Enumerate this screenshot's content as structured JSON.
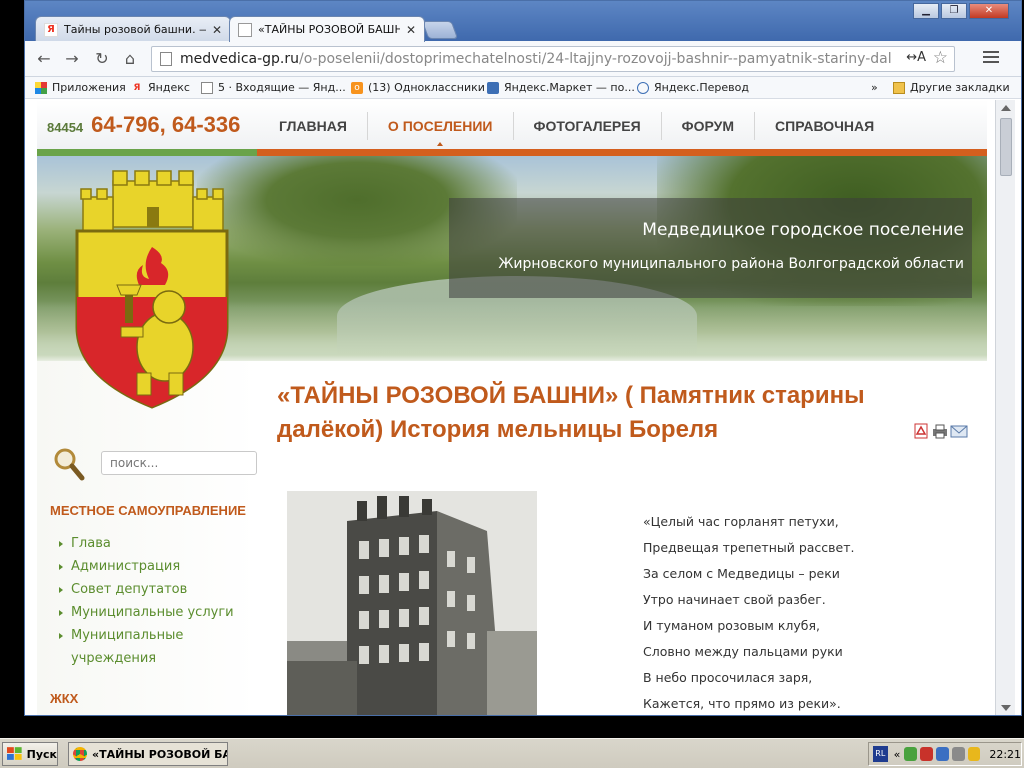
{
  "browser": {
    "tabs": [
      {
        "title": "Тайны розовой башни. — Я",
        "favicon": "yandex-icon"
      },
      {
        "title": "«ТАЙНЫ РОЗОВОЙ БАШНИ»",
        "favicon": "page-icon"
      }
    ],
    "url_host": "medvedica-gp.ru",
    "url_path": "/o-poselenii/dostoprimechatelnosti/24-ltajjny-rozovojj-bashnir--pamyatnik-stariny-dal",
    "translate_label": "↔A",
    "bookmarks": [
      {
        "label": "Приложения",
        "icon": "apps-icon"
      },
      {
        "label": "Яндекс",
        "icon": "yandex-icon"
      },
      {
        "label": "5 · Входящие — Янд...",
        "icon": "mail-icon"
      },
      {
        "label": "(13) Одноклассники",
        "icon": "ok-icon"
      },
      {
        "label": "Яндекс.Маркет — по...",
        "icon": "market-icon"
      },
      {
        "label": "Яндекс.Перевод",
        "icon": "translate-icon"
      }
    ],
    "bookmarks_more": "»",
    "other_bookmarks": "Другие закладки"
  },
  "header": {
    "phone_code": "84454",
    "phone_numbers": "64-796, 64-336",
    "menu": [
      {
        "label": "ГЛАВНАЯ",
        "active": false
      },
      {
        "label": "О ПОСЕЛЕНИИ",
        "active": true
      },
      {
        "label": "ФОТОГАЛЕРЕЯ",
        "active": false
      },
      {
        "label": "ФОРУМ",
        "active": false
      },
      {
        "label": "СПРАВОЧНАЯ",
        "active": false
      }
    ]
  },
  "banner": {
    "title": "Медведицкое городское поселение",
    "subtitle": "Жирновского муниципального района Волгоградской области"
  },
  "sidebar": {
    "search_placeholder": "поиск...",
    "heading_1": "МЕСТНОЕ САМОУПРАВЛЕНИЕ",
    "items": [
      "Глава",
      "Администрация",
      "Совет депутатов",
      "Муниципальные услуги",
      "Муниципальные",
      "учреждения"
    ],
    "heading_2": "ЖКХ"
  },
  "article": {
    "title": "«ТАЙНЫ РОЗОВОЙ БАШНИ» ( Памятник старины далёкой) История мельницы Бореля",
    "poem": [
      "«Целый час горланят петухи,",
      "Предвещая трепетный рассвет.",
      "За селом с Медведицы – реки",
      "Утро начинает свой разбег.",
      "И туманом розовым клубя,",
      "Словно между пальцами руки",
      "В небо просочилася заря,",
      "Кажется, что прямо из реки»."
    ]
  },
  "taskbar": {
    "start_label": "Пуск",
    "task_label": "«ТАЙНЫ РОЗОВОЙ БА...",
    "lang": "RL",
    "tray_expand": "«",
    "clock": "22:21"
  },
  "colors": {
    "accent_orange": "#c05a1c",
    "link_green": "#5b8d2e",
    "stripe_green": "#6aa34a",
    "stripe_orange": "#d45f1e"
  }
}
